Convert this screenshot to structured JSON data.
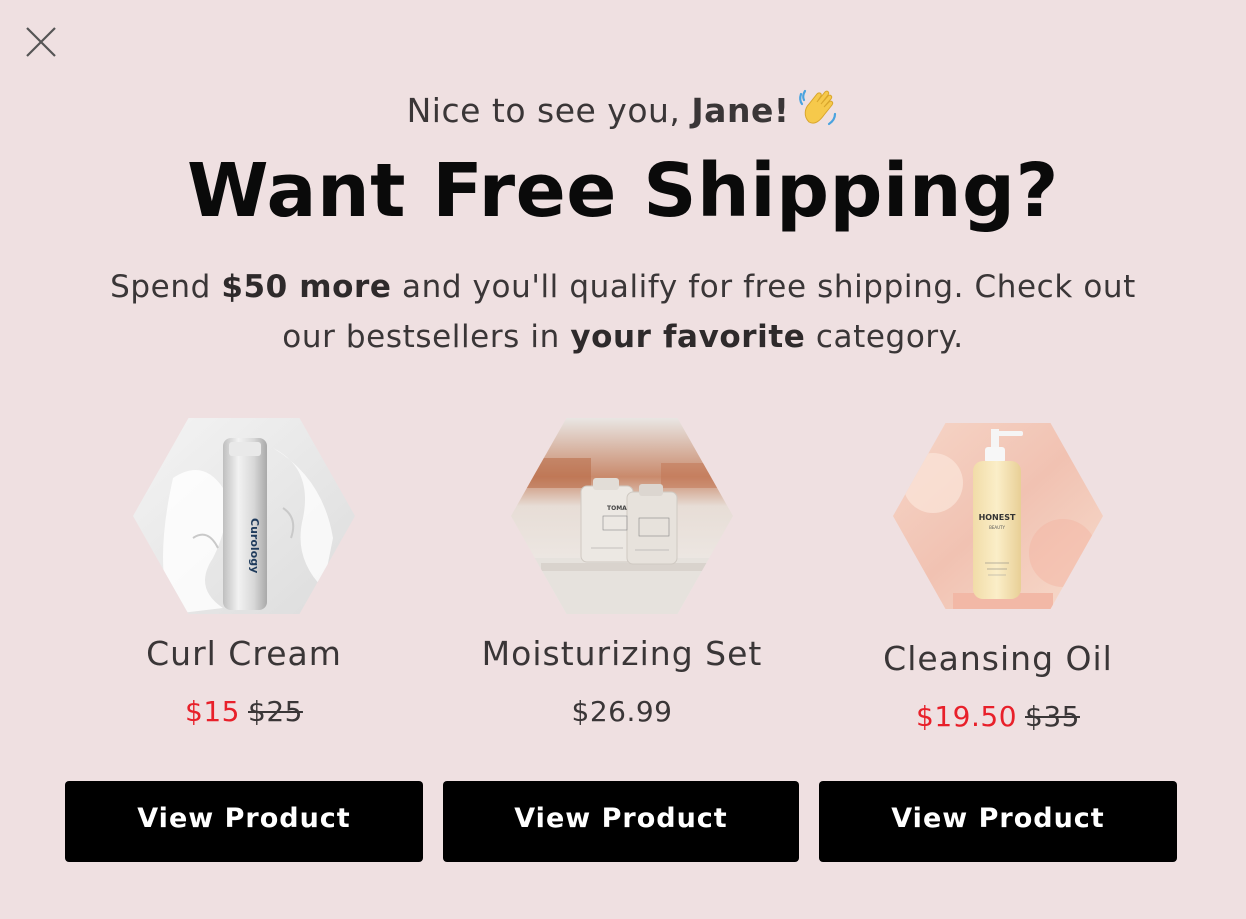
{
  "greeting": {
    "prefix": "Nice to see you, ",
    "name": "Jane!",
    "emoji_icon": "waving-hand-icon"
  },
  "headline": "Want Free Shipping?",
  "subtext": {
    "part1": "Spend ",
    "bold1": "$50 more",
    "part2": " and you'll qualify for free shipping. Check out our bestsellers in ",
    "bold2": "your favorite",
    "part3": " category."
  },
  "products": [
    {
      "name": "Curl Cream",
      "sale_price": "$15",
      "original_price": "$25",
      "image_icon": "curl-cream-bottle-image",
      "brand_label": "Curology",
      "button_label": "View Product"
    },
    {
      "name": "Moisturizing Set",
      "price": "$26.99",
      "image_icon": "moisturizing-set-bottles-image",
      "brand_label": "TOMA",
      "button_label": "View Product"
    },
    {
      "name": "Cleansing Oil",
      "sale_price": "$19.50",
      "original_price": "$35",
      "image_icon": "cleansing-oil-pump-bottle-image",
      "brand_label": "HONEST",
      "brand_sub": "BEAUTY",
      "button_label": "View Product"
    }
  ],
  "colors": {
    "background": "#efe0e1",
    "sale_price": "#e8202a",
    "button": "#000000",
    "headline": "#0a0a0a"
  }
}
